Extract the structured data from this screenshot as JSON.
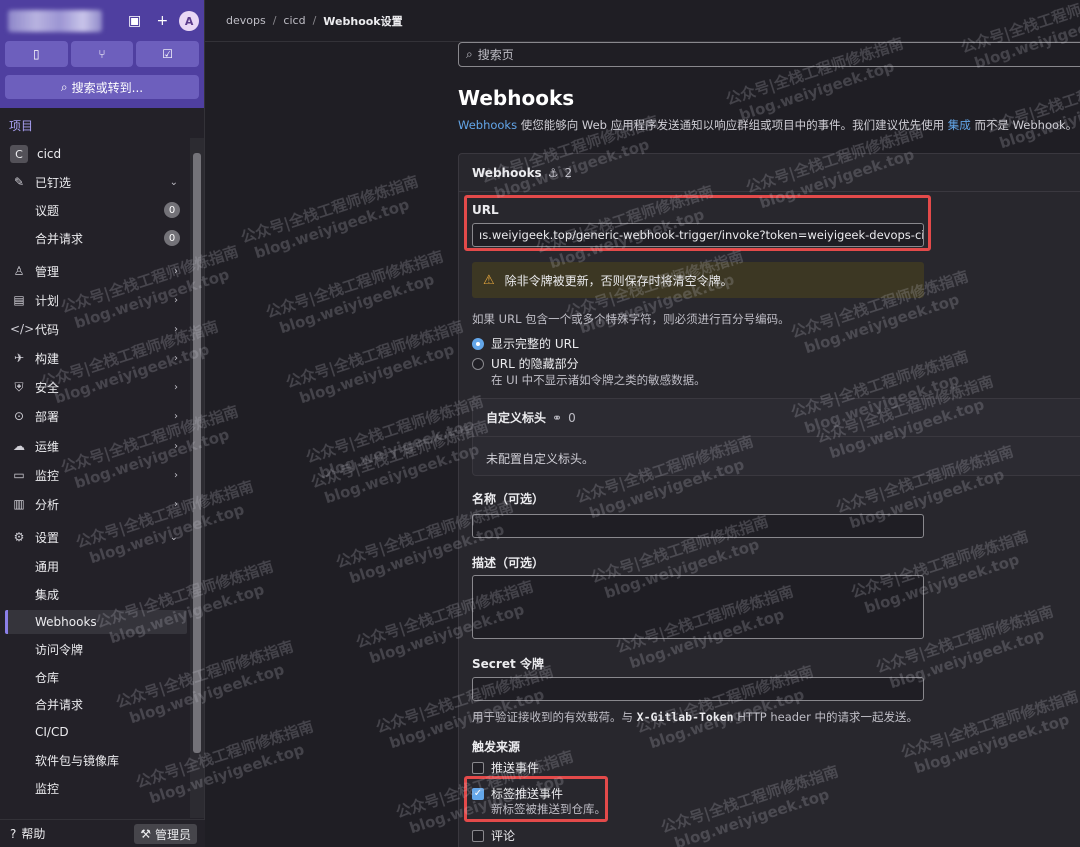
{
  "sidebar": {
    "avatar": "A",
    "search_label": "搜索或转到...",
    "section": "项目",
    "project_initial": "C",
    "project_name": "cicd",
    "items": {
      "pinned": "已钉选",
      "issues": "议题",
      "issues_count": "0",
      "mr": "合并请求",
      "mr_count": "0",
      "manage": "管理",
      "plan": "计划",
      "code": "代码",
      "build": "构建",
      "secure": "安全",
      "deploy": "部署",
      "operate": "运维",
      "monitor": "监控",
      "analyze": "分析",
      "settings": "设置",
      "general": "通用",
      "integrations": "集成",
      "webhooks": "Webhooks",
      "access_tokens": "访问令牌",
      "repository": "仓库",
      "merge_requests": "合并请求",
      "cicd": "CI/CD",
      "packages": "软件包与镜像库",
      "monitor2": "监控"
    },
    "help": "帮助",
    "admin": "管理员"
  },
  "breadcrumb": [
    "devops",
    "cicd",
    "Webhook设置"
  ],
  "search_placeholder": "搜索页",
  "page": {
    "title": "Webhooks",
    "desc_link": "Webhooks",
    "desc_mid": " 使您能够向 Web 应用程序发送通知以响应群组或项目中的事件。我们建议优先使用 ",
    "desc_link2": "集成",
    "desc_end": " 而不是 Webhook。"
  },
  "card": {
    "title": "Webhooks",
    "count": "2",
    "url_label": "URL",
    "url_value": "ıs.weiyigeek.top/generic-webhook-trigger/invoke?token=weiyigeek-devops-cicd",
    "warning": "除非令牌被更新，否则保存时将清空令牌。",
    "url_help": "如果 URL 包含一个或多个特殊字符，则必须进行百分号编码。",
    "radio_full": "显示完整的 URL",
    "radio_mask": "URL 的隐藏部分",
    "radio_mask_help": "在 UI 中不显示诸如令牌之类的敏感数据。",
    "custom_headers_title": "自定义标头",
    "custom_headers_count": "0",
    "custom_headers_empty": "未配置自定义标头。",
    "name_label": "名称（可选）",
    "desc_label": "描述（可选）",
    "secret_label": "Secret 令牌",
    "secret_help_pre": "用于验证接收到的有效载荷。与 ",
    "secret_help_code": "X-Gitlab-Token",
    "secret_help_post": " HTTP header 中的请求一起发送。",
    "trigger_label": "触发来源",
    "push_events": "推送事件",
    "tag_push_events": "标签推送事件",
    "tag_push_help": "新标签被推送到仓库。",
    "comments": "评论"
  },
  "watermark": {
    "line1": "公众号|全栈工程师修炼指南",
    "line2": "blog.weiyigeek.top"
  },
  "colors": {
    "brand": "#4f3fa0",
    "link": "#63a6e9",
    "highlight": "#e34a4a"
  }
}
